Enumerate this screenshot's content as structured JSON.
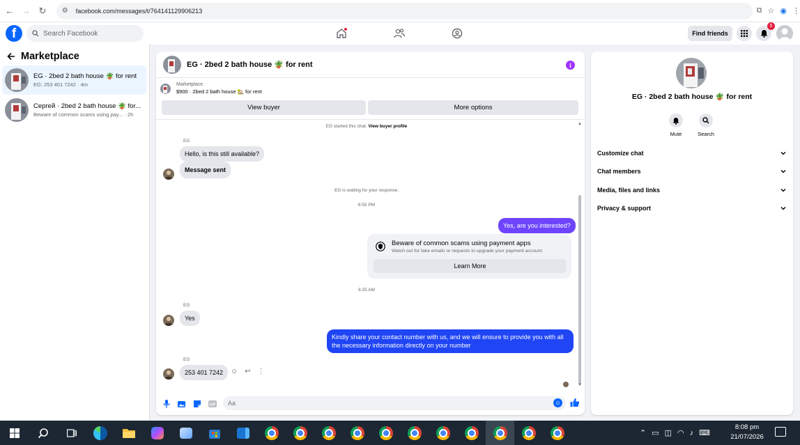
{
  "browser": {
    "url": "facebook.com/messages/t/764141129906213"
  },
  "header": {
    "search_placeholder": "Search Facebook",
    "find_friends": "Find friends",
    "notification_count": "5"
  },
  "sidebar": {
    "title": "Marketplace",
    "conversations": [
      {
        "title": "EG · 2bed 2 bath house 🪴 for rent",
        "subtitle": "EG: 253 401 7242 · 4m",
        "active": true
      },
      {
        "title": "Сергей · 2bed 2 bath house 🪴 for...",
        "subtitle": "Beware of common scams using pay... · 2h",
        "active": false
      }
    ]
  },
  "chat": {
    "title": "EG · 2bed 2 bath house 🪴 for rent",
    "listing_label": "Marketplace",
    "listing_desc": "$900 · 2bed 2 bath house 🏡 for rent",
    "view_buyer": "View buyer",
    "more_options": "More options",
    "started_text": "EG started this chat.",
    "view_buyer_profile": "View buyer profile",
    "waiting_text": "EG is waiting for your response.",
    "sender_name": "EG",
    "messages": {
      "m1": "Hello, is this still available?",
      "m2": "Message sent",
      "time1": "6:55 PM",
      "m3": "Yes, are you interested?",
      "time2": "6:25 AM",
      "m4": "Yes",
      "m5": "Kindly share your contact number with us, and we will ensure to provide you with all the necessary information directly on your number",
      "m6": "253 401 7242"
    },
    "scam_card": {
      "title": "Beware of common scams using payment apps",
      "subtitle": "Watch out for fake emails or requests to upgrade your payment account.",
      "button": "Learn More"
    },
    "composer_placeholder": "Aa"
  },
  "info_panel": {
    "title": "EG · 2bed 2 bath house 🪴 for rent",
    "mute": "Mute",
    "search": "Search",
    "sections": [
      "Customize chat",
      "Chat members",
      "Media, files and links",
      "Privacy & support"
    ]
  },
  "taskbar": {
    "time": "8:08 pm",
    "date": "21/07/2026"
  },
  "colors": {
    "brand": "#0866ff",
    "outgoing_bubble": "#1f45f5",
    "info_button": "#a033ff",
    "taskbar": "#1c2733"
  }
}
